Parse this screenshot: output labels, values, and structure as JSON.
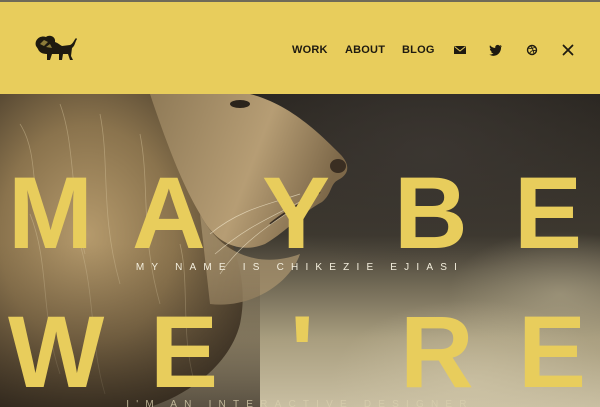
{
  "header": {
    "background_color": "#e8cd5c",
    "logo": "lion-logo",
    "nav": [
      {
        "label": "WORK"
      },
      {
        "label": "ABOUT"
      },
      {
        "label": "BLOG"
      }
    ],
    "icons": [
      "email-icon",
      "twitter-icon",
      "dribbble-icon",
      "close-icon"
    ]
  },
  "hero": {
    "image": "lion-photo",
    "headline_line1": [
      "M",
      "A",
      "Y",
      "B",
      "E"
    ],
    "headline_line2": [
      "W",
      "E",
      "'",
      "R",
      "E"
    ],
    "subtitle": "MY NAME IS CHIKEZIE EJIASI",
    "subtitle_next": "I'M AN INTERACTIVE DESIGNER",
    "accent_color": "#e8cd5c"
  }
}
